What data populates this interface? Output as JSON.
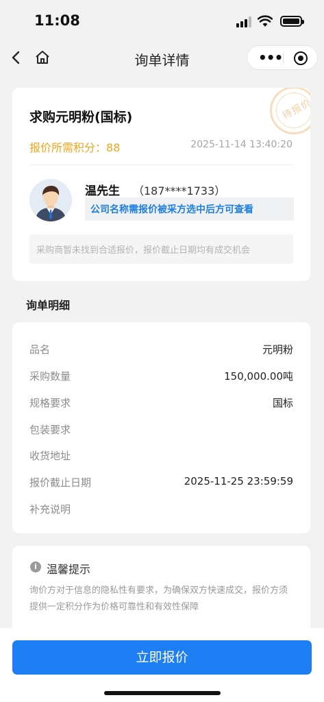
{
  "status_bar": {
    "time": "11:08"
  },
  "nav": {
    "title": "询单详情",
    "back_icon": "chevron-left-icon",
    "home_icon": "home-icon",
    "more_icon": "more-dots-icon",
    "close_icon": "target-close-icon"
  },
  "inquiry": {
    "title": "求购元明粉(国标)",
    "stamp": "待报价",
    "points_label": "报价所需积分：",
    "points_value": "88",
    "datetime": "2025-11-14 13:40:20",
    "buyer_name": "温先生",
    "buyer_phone": "（187****1733）",
    "company_notice": "公司名称需报价被采方选中后方可查看",
    "status_notice": "采购商暂未找到合适报价，报价截止日期均有成交机会"
  },
  "details": {
    "section_title": "询单明细",
    "rows": [
      {
        "label": "品名",
        "value": "元明粉"
      },
      {
        "label": "采购数量",
        "value": "150,000.00吨"
      },
      {
        "label": "规格要求",
        "value": "国标"
      },
      {
        "label": "包装要求",
        "value": ""
      },
      {
        "label": "收货地址",
        "value": ""
      },
      {
        "label": "报价截止日期",
        "value": "2025-11-25 23:59:59"
      },
      {
        "label": "补充说明",
        "value": ""
      }
    ]
  },
  "tips": {
    "title": "温馨提示",
    "body": "询价方对于信息的隐私性有要求，为确保双方快速成交，报价方须提供一定积分作为价格可靠性和有效性保障"
  },
  "action": {
    "quote_button": "立即报价"
  },
  "colors": {
    "accent": "#1e7ff5",
    "points": "#f2a51c",
    "company_tip": "#1f7fe0"
  }
}
